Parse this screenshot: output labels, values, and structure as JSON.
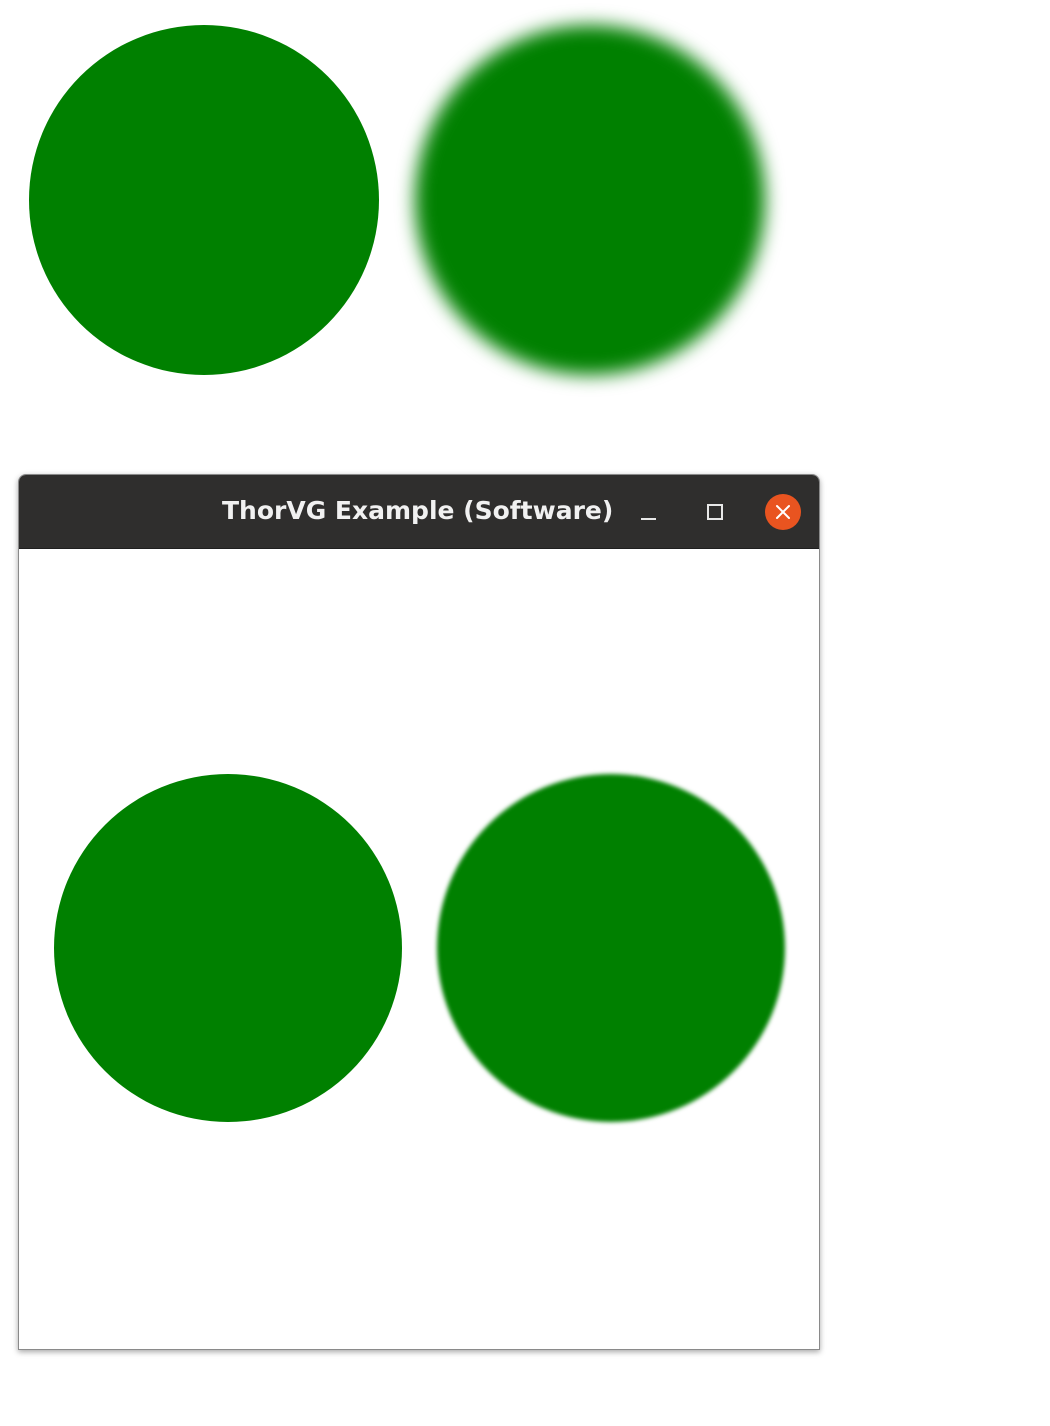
{
  "window": {
    "title": "ThorVG Example (Software)",
    "controls": {
      "minimize_icon": "minimize-icon",
      "maximize_icon": "maximize-icon",
      "close_icon": "close-icon"
    }
  },
  "colors": {
    "circle_fill": "#008000",
    "titlebar_bg": "#2f2e2d",
    "close_button": "#e95420",
    "canvas_bg": "#ffffff"
  }
}
